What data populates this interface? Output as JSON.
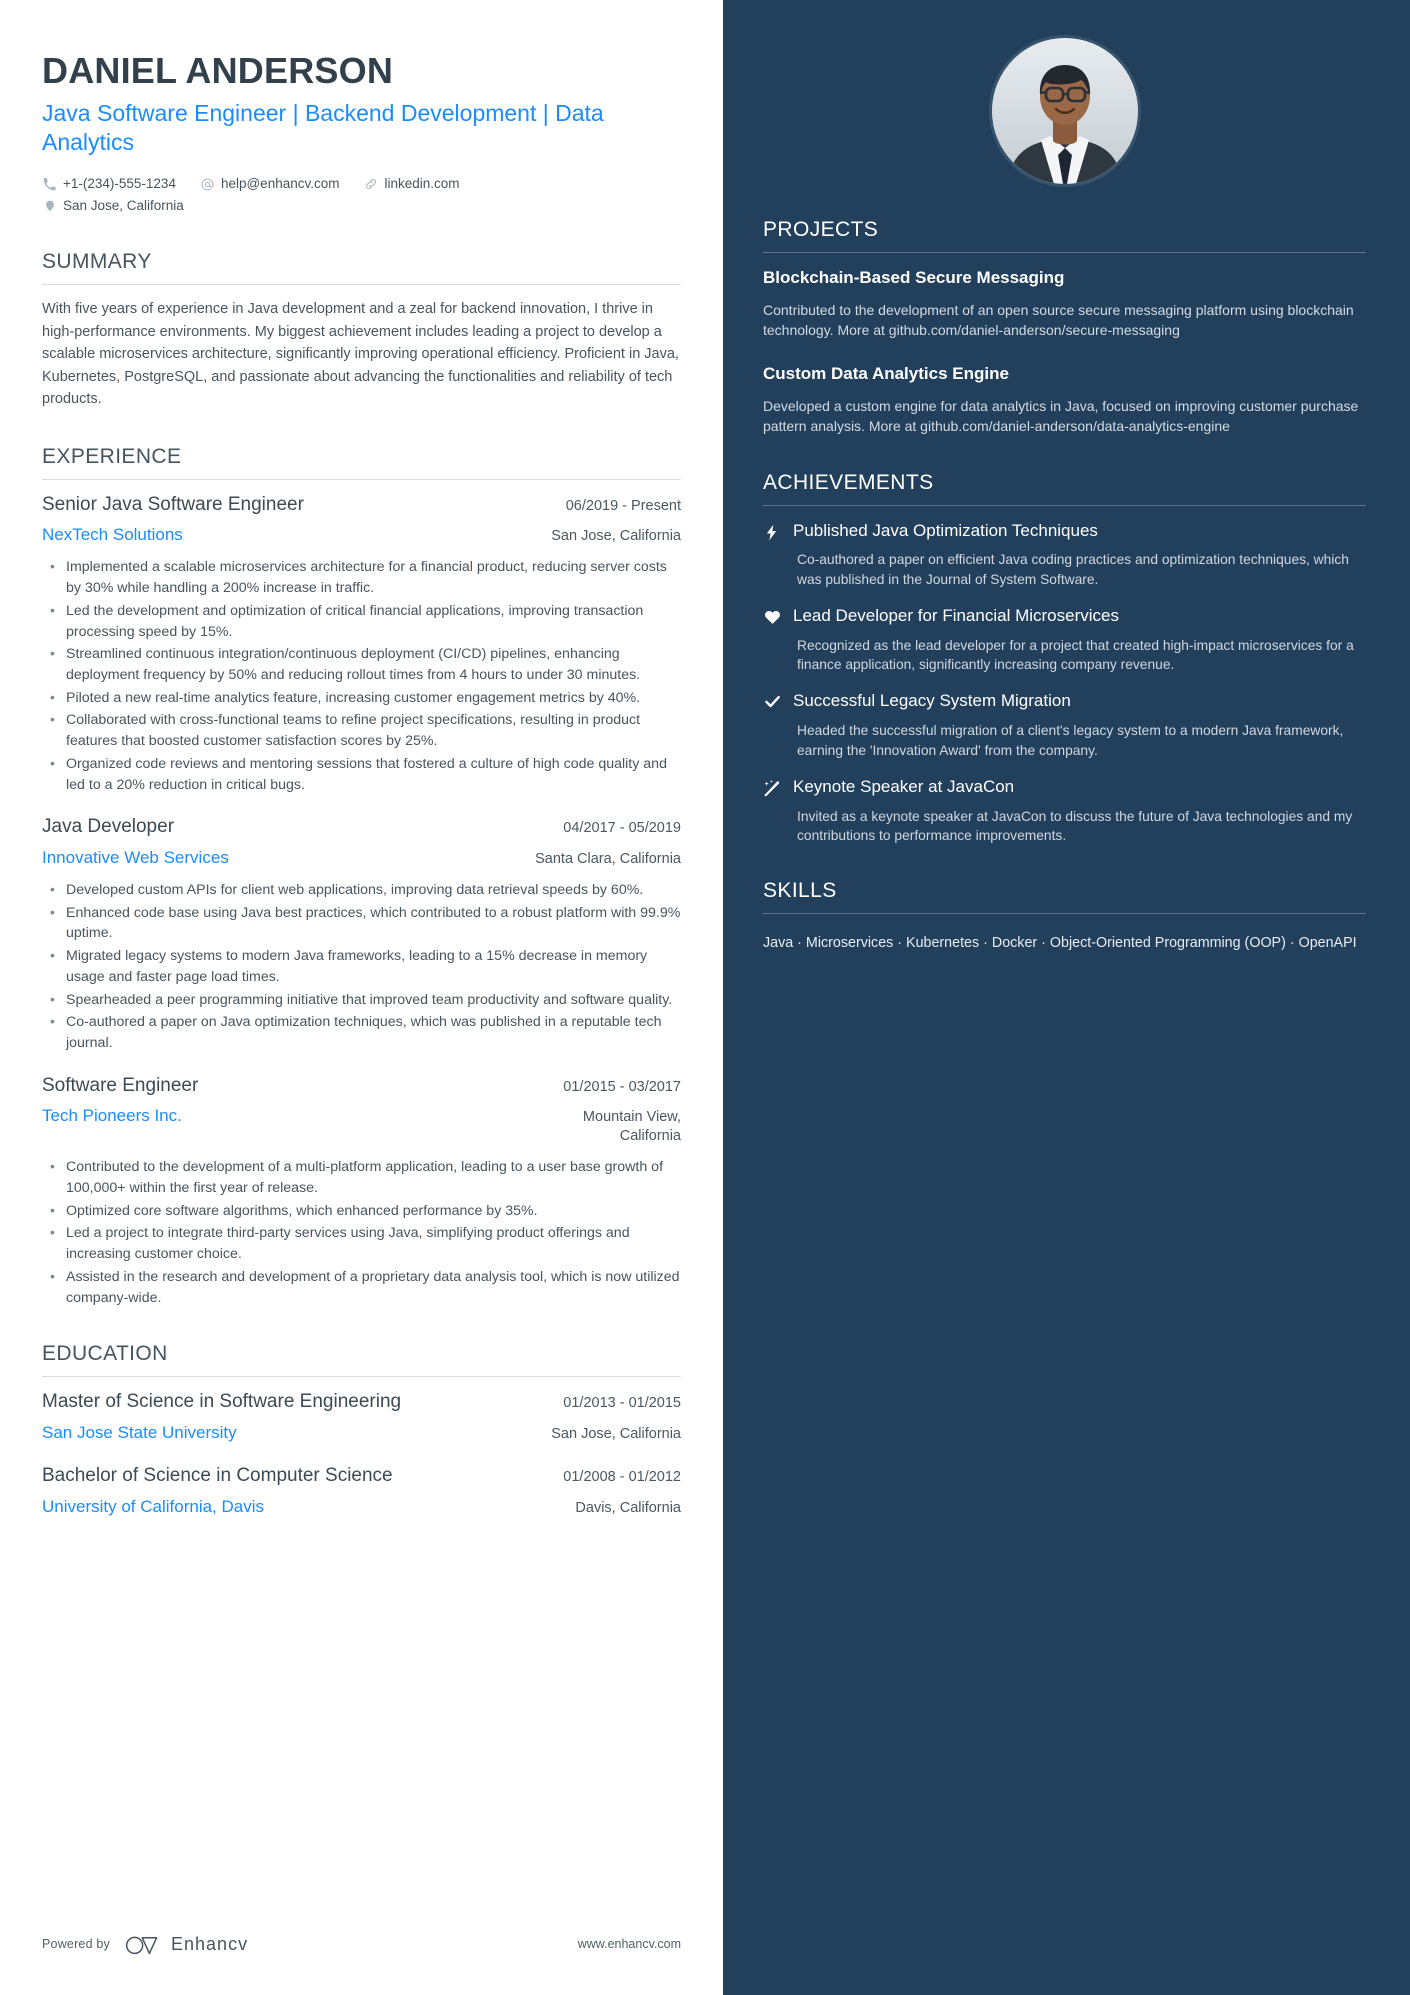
{
  "colors": {
    "accent_blue": "#1a8cff",
    "sidebar_bg": "#22405c",
    "heading": "#46555f",
    "body_text": "#48555f"
  },
  "header": {
    "name": "DANIEL ANDERSON",
    "headline": "Java Software Engineer | Backend Development | Data Analytics",
    "contact": {
      "phone": "+1-(234)-555-1234",
      "email": "help@enhancv.com",
      "website": "linkedin.com",
      "location": "San Jose, California"
    }
  },
  "summary": {
    "heading": "SUMMARY",
    "text": "With five years of experience in Java development and a zeal for backend innovation, I thrive in high-performance environments. My biggest achievement includes leading a project to develop a scalable microservices architecture, significantly improving operational efficiency. Proficient in Java, Kubernetes, PostgreSQL, and passionate about advancing the functionalities and reliability of tech products."
  },
  "experience": {
    "heading": "EXPERIENCE",
    "entries": [
      {
        "role": "Senior Java Software Engineer",
        "date": "06/2019 - Present",
        "company": "NexTech Solutions",
        "location": "San Jose, California",
        "bullets": [
          "Implemented a scalable microservices architecture for a financial product, reducing server costs by 30% while handling a 200% increase in traffic.",
          "Led the development and optimization of critical financial applications, improving transaction processing speed by 15%.",
          "Streamlined continuous integration/continuous deployment (CI/CD) pipelines, enhancing deployment frequency by 50% and reducing rollout times from 4 hours to under 30 minutes.",
          "Piloted a new real-time analytics feature, increasing customer engagement metrics by 40%.",
          "Collaborated with cross-functional teams to refine project specifications, resulting in product features that boosted customer satisfaction scores by 25%.",
          "Organized code reviews and mentoring sessions that fostered a culture of high code quality and led to a 20% reduction in critical bugs."
        ]
      },
      {
        "role": "Java Developer",
        "date": "04/2017 - 05/2019",
        "company": "Innovative Web Services",
        "location": "Santa Clara, California",
        "bullets": [
          "Developed custom APIs for client web applications, improving data retrieval speeds by 60%.",
          "Enhanced code base using Java best practices, which contributed to a robust platform with 99.9% uptime.",
          "Migrated legacy systems to modern Java frameworks, leading to a 15% decrease in memory usage and faster page load times.",
          "Spearheaded a peer programming initiative that improved team productivity and software quality.",
          "Co-authored a paper on Java optimization techniques, which was published in a reputable tech journal."
        ]
      },
      {
        "role": "Software Engineer",
        "date": "01/2015 - 03/2017",
        "company": "Tech Pioneers Inc.",
        "location": "Mountain View, California",
        "bullets": [
          "Contributed to the development of a multi-platform application, leading to a user base growth of 100,000+ within the first year of release.",
          "Optimized core software algorithms, which enhanced performance by 35%.",
          "Led a project to integrate third-party services using Java, simplifying product offerings and increasing customer choice.",
          "Assisted in the research and development of a proprietary data analysis tool, which is now utilized company-wide."
        ]
      }
    ]
  },
  "education": {
    "heading": "EDUCATION",
    "entries": [
      {
        "degree": "Master of Science in Software Engineering",
        "date": "01/2013 - 01/2015",
        "school": "San Jose State University",
        "location": "San Jose, California"
      },
      {
        "degree": "Bachelor of Science in Computer Science",
        "date": "01/2008 - 01/2012",
        "school": "University of California, Davis",
        "location": "Davis, California"
      }
    ]
  },
  "projects": {
    "heading": "PROJECTS",
    "items": [
      {
        "name": "Blockchain-Based Secure Messaging",
        "description": "Contributed to the development of an open source secure messaging platform using blockchain technology. More at github.com/daniel-anderson/secure-messaging"
      },
      {
        "name": "Custom Data Analytics Engine",
        "description": "Developed a custom engine for data analytics in Java, focused on improving customer purchase pattern analysis. More at github.com/daniel-anderson/data-analytics-engine"
      }
    ]
  },
  "achievements": {
    "heading": "ACHIEVEMENTS",
    "items": [
      {
        "icon": "lightning-bolt-icon",
        "title": "Published Java Optimization Techniques",
        "description": "Co-authored a paper on efficient Java coding practices and optimization techniques, which was published in the Journal of System Software."
      },
      {
        "icon": "heart-icon",
        "title": "Lead Developer for Financial Microservices",
        "description": "Recognized as the lead developer for a project that created high-impact microservices for a finance application, significantly increasing company revenue."
      },
      {
        "icon": "check-icon",
        "title": "Successful Legacy System Migration",
        "description": "Headed the successful migration of a client's legacy system to a modern Java framework, earning the 'Innovation Award' from the company."
      },
      {
        "icon": "magic-wand-icon",
        "title": "Keynote Speaker at JavaCon",
        "description": "Invited as a keynote speaker at JavaCon to discuss the future of Java technologies and my contributions to performance improvements."
      }
    ]
  },
  "skills": {
    "heading": "SKILLS",
    "items": [
      "Java",
      "Microservices",
      "Kubernetes",
      "Docker",
      "Object-Oriented Programming (OOP)",
      "OpenAPI"
    ],
    "separator": "·"
  },
  "footer": {
    "powered_by": "Powered by",
    "brand": "Enhancv",
    "site": "www.enhancv.com"
  }
}
